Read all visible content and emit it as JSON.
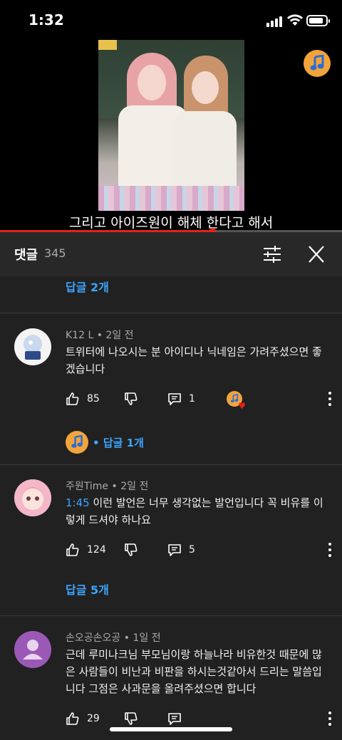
{
  "status_bar": {
    "time": "1:32"
  },
  "video": {
    "subtitle": "그리고 아이즈원이 해체 한다고 해서",
    "progress_fraction": 0.62
  },
  "comments_panel": {
    "title": "댓글",
    "count": "345",
    "top_replies_link": "답글 2개"
  },
  "comments": [
    {
      "author": "K12 L",
      "age": "2일 전",
      "text": "트위터에 나오시는 분 아이디나 닉네임은 가려주셨으면 좋겠습니다",
      "likes": "85",
      "reply_count": "1",
      "replies_label": "답글 1개"
    },
    {
      "author": "주원Time",
      "age": "2일 전",
      "timestamp": "1:45",
      "text": " 이런 발언은 너무 생각없는 발언입니다 꼭 비유를 이렇게 드셔야 하나요",
      "likes": "124",
      "reply_count": "5",
      "replies_label": "답글 5개"
    },
    {
      "author": "손오공손오공",
      "age": "1일 전",
      "text": "근데 루미나크님 부모님이랑 하늘나라 비유한것 때문에 많은 사람들이 비난과 비판을 하시는것같아서 드리는 말씀입니다 그점은 사과문을 올려주셨으면 합니다",
      "likes": "29"
    }
  ],
  "separator": "•",
  "colors": {
    "accent_blue": "#3ea6ff",
    "progress_red": "#e62117",
    "panel_bg": "#212121",
    "header_bg": "#282828"
  },
  "icons": [
    "signal-icon",
    "wifi-icon",
    "battery-icon",
    "music-note-icon",
    "sort-filter-icon",
    "close-icon",
    "thumbs-up-icon",
    "thumbs-down-icon",
    "reply-icon",
    "more-vert-icon",
    "heart-icon"
  ]
}
